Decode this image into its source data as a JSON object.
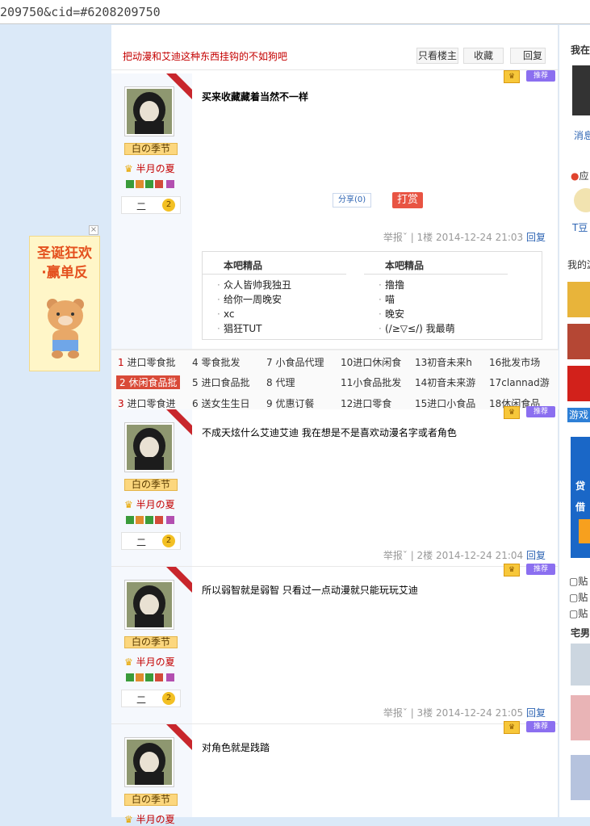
{
  "browser": {
    "url_fragment": "209750&cid=#6208209750"
  },
  "thread": {
    "title": "把动漫和艾迪这种东西挂钩的不如狗吧",
    "buttons": {
      "only_op": "只看楼主",
      "favorite": "收藏",
      "reply": "回复"
    }
  },
  "ad": {
    "line1": "圣诞狂欢",
    "line2": "·赢单反"
  },
  "user": {
    "name": "白の季节",
    "title": "半月の夏",
    "level_name": "二",
    "level": "2",
    "op_badge": "楼主"
  },
  "post_actions": {
    "push": "推荐",
    "report": "举报",
    "reply": "回复"
  },
  "posts": [
    {
      "content": "买来收藏藏着当然不一样",
      "floor": "1楼",
      "time": "2014-12-24 21:03",
      "share": "分享(0)",
      "reward": "打赏"
    },
    {
      "content": "不成天炫什么艾迪艾迪 我在想是不是喜欢动漫名字或者角色",
      "floor": "2楼",
      "time": "2014-12-24 21:04"
    },
    {
      "content": "所以弱智就是弱智 只看过一点动漫就只能玩玩艾迪",
      "floor": "3楼",
      "time": "2014-12-24 21:05"
    },
    {
      "content": "对角色就是践踏"
    }
  ],
  "featured": {
    "heading_left": "本吧精品",
    "heading_right": "本吧精品",
    "left_items": [
      "众人皆帅我独丑",
      "给你一周晚安",
      "xc",
      "猖狂TUT"
    ],
    "right_items": [
      "撸撸",
      "喵",
      "晚安",
      "(/≥▽≤/) 我最萌"
    ]
  },
  "rankings": {
    "row1": [
      {
        "n": "1",
        "t": "进口零食批"
      },
      {
        "n": "4",
        "t": "零食批发"
      },
      {
        "n": "7",
        "t": "小食品代理"
      },
      {
        "n": "10",
        "t": "进口休闲食"
      },
      {
        "n": "13",
        "t": "初音未来h"
      },
      {
        "n": "16",
        "t": "批发市场"
      }
    ],
    "row2": [
      {
        "n": "2",
        "t": "休闲食品批"
      },
      {
        "n": "5",
        "t": "进口食品批"
      },
      {
        "n": "8",
        "t": "代理"
      },
      {
        "n": "11",
        "t": "小食品批发"
      },
      {
        "n": "14",
        "t": "初音未来游"
      },
      {
        "n": "17",
        "t": "clannad游"
      }
    ],
    "row3": [
      {
        "n": "3",
        "t": "进口零食进"
      },
      {
        "n": "6",
        "t": "送女生生日"
      },
      {
        "n": "9",
        "t": "优惠订餐"
      },
      {
        "n": "12",
        "t": "进口零食"
      },
      {
        "n": "15",
        "t": "进口小食品"
      },
      {
        "n": "18",
        "t": "休闲食品"
      }
    ]
  },
  "sidebar": {
    "heading": "我在",
    "msg": "消息",
    "app": "应",
    "tdou": "T豆",
    "mine": "我的游",
    "game_label": "游戏",
    "ad1": "贷",
    "ad2": "借",
    "links": [
      "贴",
      "贴",
      "贴"
    ],
    "otaku": "宅男"
  }
}
